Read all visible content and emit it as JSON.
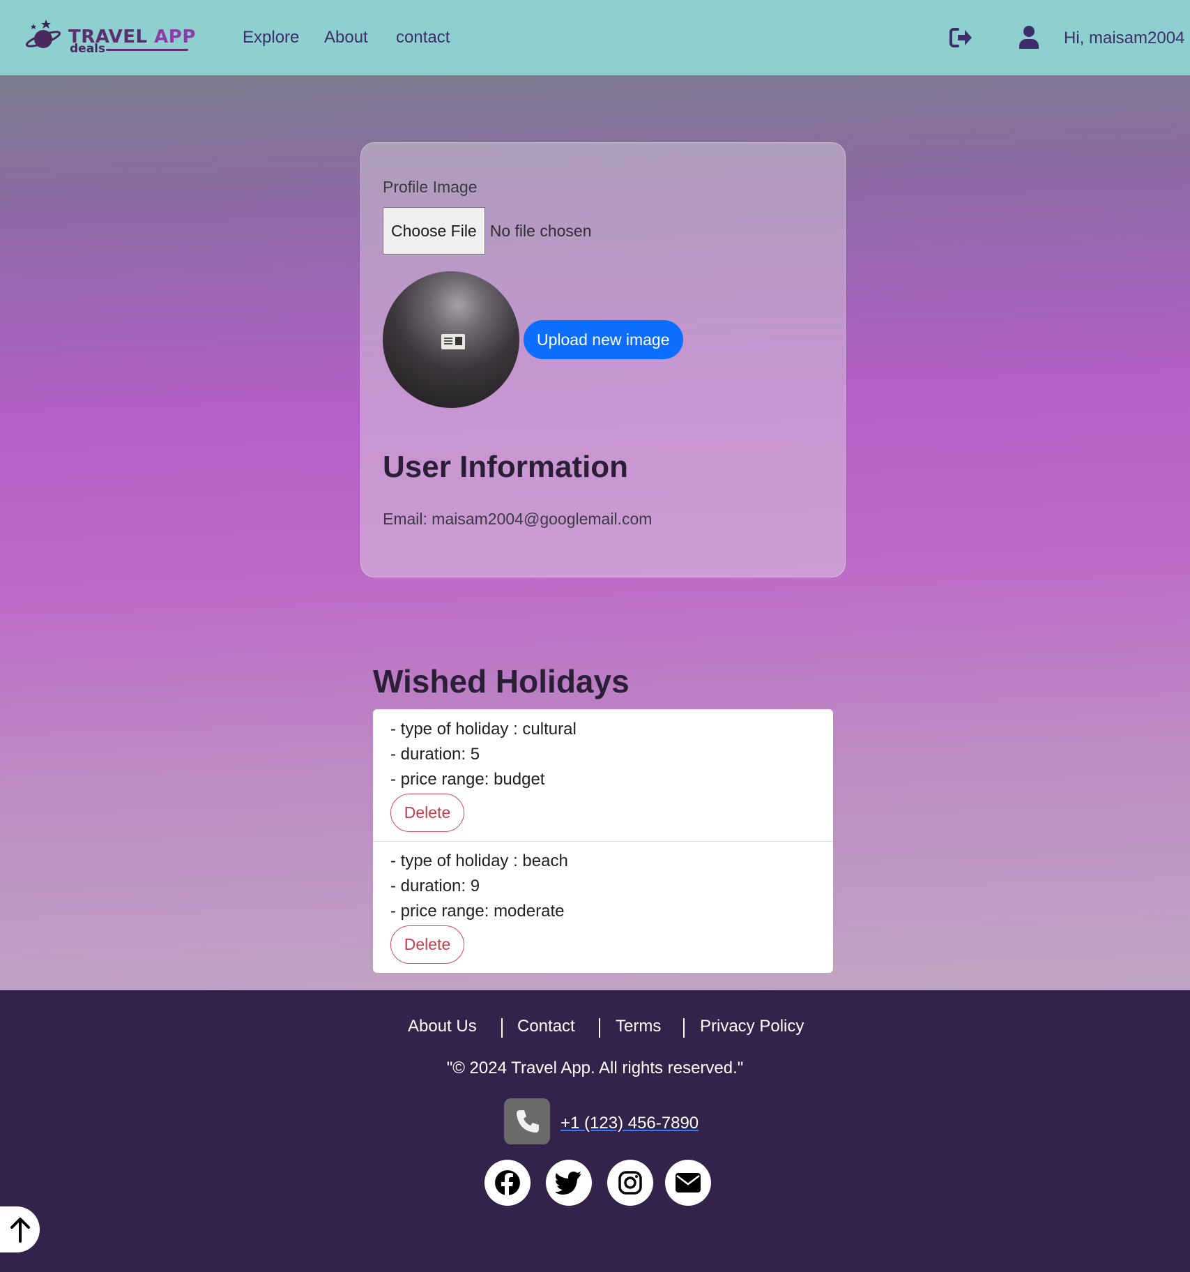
{
  "navbar": {
    "logo": {
      "brand_main": "TRAVEL",
      "brand_accent": "APP",
      "brand_sub": "deals",
      "icon": "planet-logo-icon"
    },
    "links": [
      "Explore",
      "About",
      "contact"
    ],
    "icons": [
      "logout-icon",
      "user-icon"
    ],
    "greeting": "Hi, maisam2004"
  },
  "profile": {
    "image_label": "Profile Image",
    "choose_file_label": "Choose File",
    "file_status": "No file chosen",
    "upload_button": "Upload new image",
    "section_title": "User Information",
    "email_line": "Email: maisam2004@googlemail.com"
  },
  "wished": {
    "title": "Wished Holidays",
    "items": [
      {
        "type_line": "- type of holiday : cultural",
        "duration_line": "- duration: 5",
        "price_line": "- price range: budget",
        "delete_label": "Delete"
      },
      {
        "type_line": "- type of holiday : beach",
        "duration_line": "- duration: 9",
        "price_line": "- price range: moderate",
        "delete_label": "Delete"
      }
    ]
  },
  "footer": {
    "links": [
      "About Us",
      "Contact",
      "Terms",
      "Privacy Policy"
    ],
    "copyright": "\"© 2024 Travel App. All rights reserved.\"",
    "phone": "+1 (123) 456-7890",
    "icons": [
      "phone-icon",
      "facebook-icon",
      "twitter-icon",
      "instagram-icon",
      "envelope-icon",
      "arrow-up-icon"
    ]
  },
  "colors": {
    "navbar_bg": "#8ecfcf",
    "nav_text": "#3d2e6b",
    "primary_button": "#0d6efd",
    "delete_button": "#c73b4a",
    "footer_bg": "#33234a"
  }
}
